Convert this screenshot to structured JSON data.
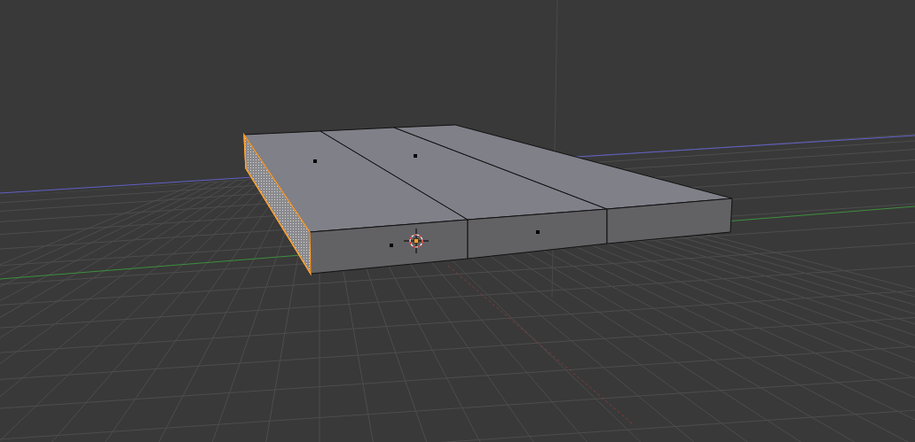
{
  "viewport": {
    "faces": [
      {
        "kind": "side",
        "selected": true
      },
      {
        "kind": "top",
        "selected": false
      },
      {
        "kind": "top",
        "selected": false
      },
      {
        "kind": "top",
        "selected": false
      },
      {
        "kind": "front",
        "selected": false
      },
      {
        "kind": "front",
        "selected": false
      },
      {
        "kind": "front",
        "selected": false
      }
    ]
  }
}
